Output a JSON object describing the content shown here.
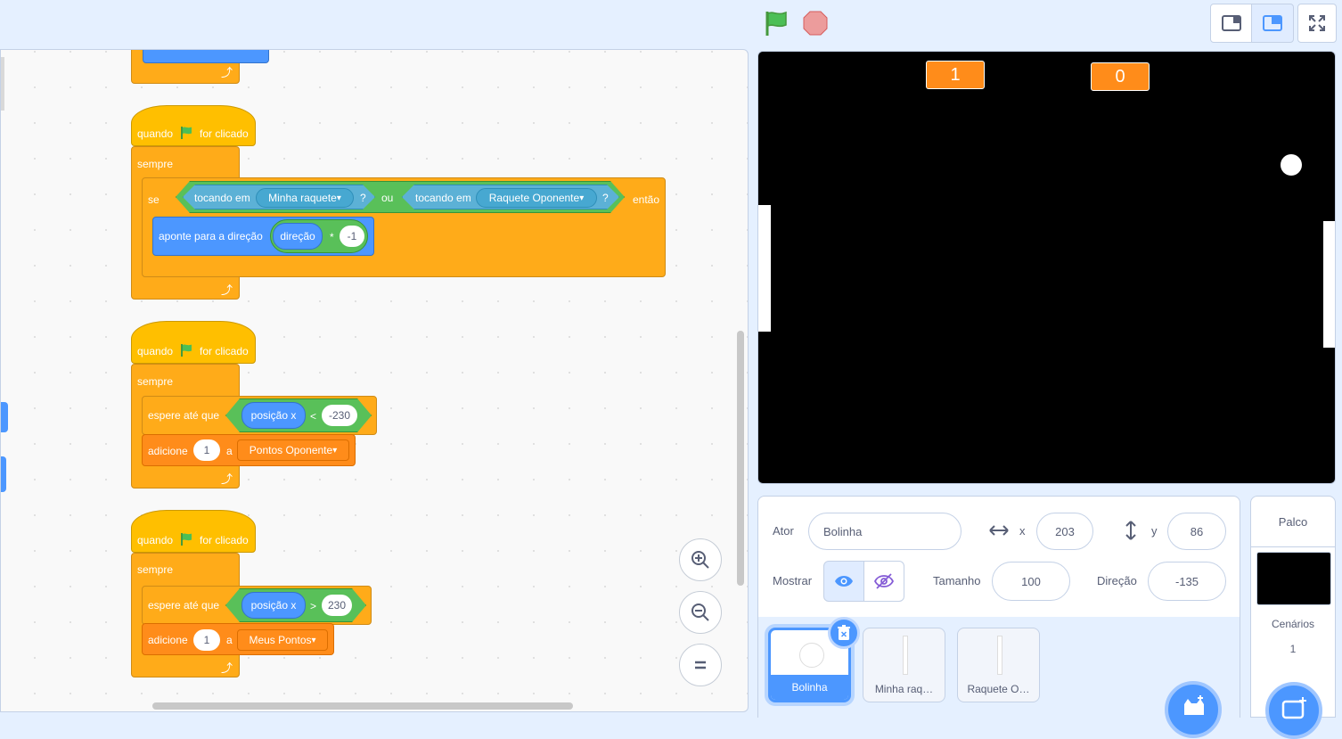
{
  "colors": {
    "events": "#ffbf00",
    "control": "#ffab19",
    "variables": "#ff8c1a",
    "motion": "#4c97ff",
    "operators": "#59c059",
    "sensing": "#5cb1d6",
    "accent": "#4c97ff"
  },
  "top": {
    "flag_icon": "green-flag-icon",
    "stop_icon": "stop-icon"
  },
  "scripts": {
    "s2": {
      "hat": {
        "quando": "quando",
        "for_clicado": "for clicado"
      },
      "sempre": "sempre",
      "se": "se",
      "tocando1": "tocando em",
      "obj1": "Minha raquete",
      "q1": "?",
      "ou": "ou",
      "tocando2": "tocando em",
      "obj2": "Raquete Oponente",
      "q2": "?",
      "entao": "então",
      "aponte": "aponte para a direção",
      "direcao": "direção",
      "mult": "*",
      "neg1": "-1"
    },
    "s3": {
      "hat": {
        "quando": "quando",
        "for_clicado": "for clicado"
      },
      "sempre": "sempre",
      "espere": "espere até que",
      "posx": "posição x",
      "op": "<",
      "val": "-230",
      "adicione": "adicione",
      "amount": "1",
      "a": "a",
      "var": "Pontos Oponente"
    },
    "s4": {
      "hat": {
        "quando": "quando",
        "for_clicado": "for clicado"
      },
      "sempre": "sempre",
      "espere": "espere até que",
      "posx": "posição x",
      "op": ">",
      "val": "230",
      "adicione": "adicione",
      "amount": "1",
      "a": "a",
      "var": "Meus Pontos"
    }
  },
  "stage": {
    "score_left": "1",
    "score_right": "0"
  },
  "sprite_info": {
    "ator_label": "Ator",
    "ator_value": "Bolinha",
    "x_label": "x",
    "x_value": "203",
    "y_label": "y",
    "y_value": "86",
    "mostrar_label": "Mostrar",
    "tamanho_label": "Tamanho",
    "tamanho_value": "100",
    "direcao_label": "Direção",
    "direcao_value": "-135"
  },
  "sprites": [
    {
      "name": "Bolinha",
      "selected": true
    },
    {
      "name": "Minha raq…",
      "selected": false
    },
    {
      "name": "Raquete O…",
      "selected": false
    }
  ],
  "stage_panel": {
    "title": "Palco",
    "cenarios_label": "Cenários",
    "cenarios_count": "1"
  }
}
